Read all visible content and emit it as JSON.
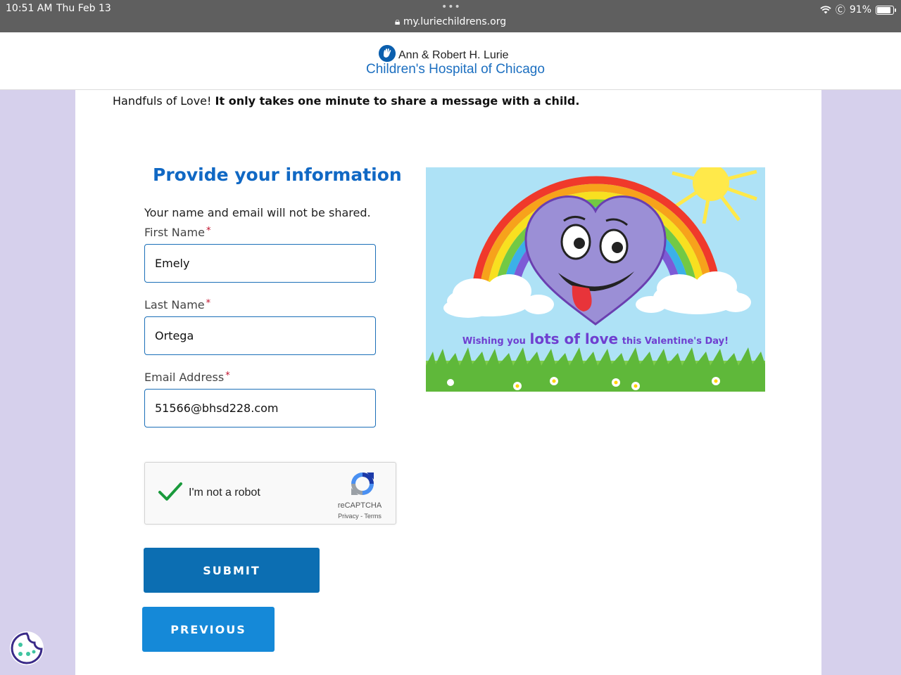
{
  "status_bar": {
    "time": "10:51 AM",
    "date": "Thu Feb 13",
    "url": "my.luriechildrens.org",
    "battery": "91%",
    "wifi_icon": "wifi-icon",
    "lock_icon": "lock-icon"
  },
  "header": {
    "logo_line1": "Ann & Robert H. Lurie",
    "logo_line2": "Children's Hospital of Chicago"
  },
  "intro": {
    "plain": "Handfuls of Love!",
    "bold": "It only takes one minute to share a message with a child."
  },
  "form": {
    "title": "Provide your information",
    "subtitle": "Your name and email will not be shared.",
    "first_name": {
      "label": "First Name",
      "required": "*",
      "value": "Emely"
    },
    "last_name": {
      "label": "Last Name",
      "required": "*",
      "value": "Ortega"
    },
    "email": {
      "label": "Email Address",
      "required": "*",
      "value": "51566@bhsd228.com"
    }
  },
  "recaptcha": {
    "label": "I'm not a robot",
    "brand": "reCAPTCHA",
    "privacy": "Privacy",
    "separator": " - ",
    "terms": "Terms",
    "checked": true
  },
  "buttons": {
    "submit": "SUBMIT",
    "previous": "PREVIOUS"
  },
  "illustration": {
    "caption_pre": "Wishing you",
    "caption_big": "lots of love",
    "caption_post": "this Valentine's Day!"
  },
  "colors": {
    "brand_blue": "#1068c4",
    "submit_bg": "#0c6eb2",
    "previous_bg": "#1589d8",
    "page_bg": "#d6d0ec",
    "required": "#c0102b"
  }
}
